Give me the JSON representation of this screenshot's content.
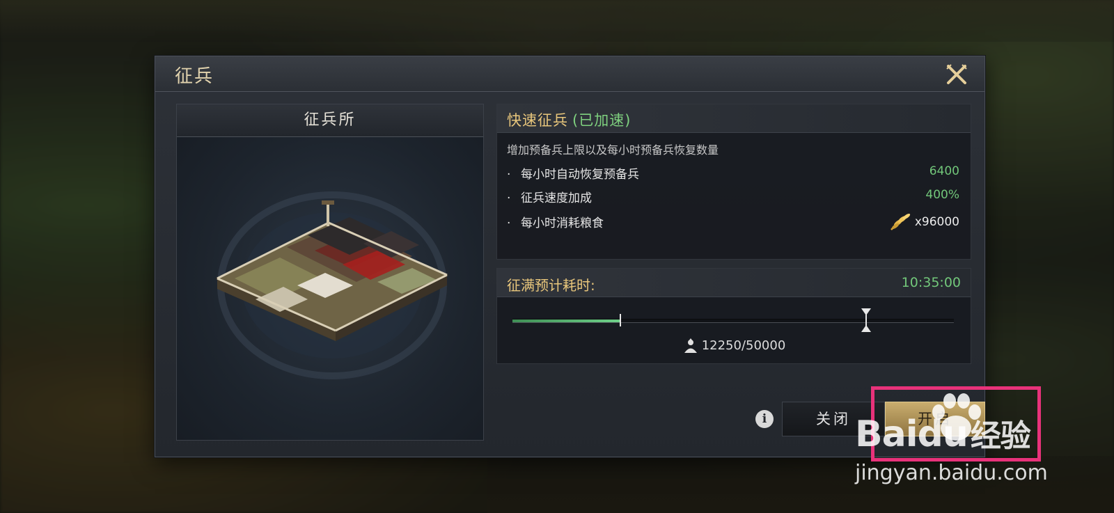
{
  "dialog": {
    "title": "征兵",
    "close_icon": "close-x-icon"
  },
  "building_panel": {
    "title": "征兵所",
    "image": "recruitment-camp-building"
  },
  "info": {
    "title": "快速征兵",
    "accelerated": "(已加速)",
    "description": "增加预备兵上限以及每小时预备兵恢复数量",
    "stats": [
      {
        "bullet": "·",
        "label": "每小时自动恢复预备兵",
        "value": "6400"
      },
      {
        "bullet": "·",
        "label": "征兵速度加成",
        "value": "400%"
      },
      {
        "bullet": "·",
        "label": "每小时消耗粮食",
        "value": "x96000",
        "icon": "grain-icon"
      }
    ]
  },
  "timer": {
    "label": "征满预计耗时:",
    "value": "10:35:00",
    "slider_progress": 0.245,
    "slider_max_marker": 0.802,
    "count_text": "12250/50000",
    "count_icon": "soldier-icon"
  },
  "buttons": {
    "info": "i",
    "close": "关闭",
    "start": "开启"
  },
  "watermark": {
    "logo_left": "Bai",
    "logo_right": "du",
    "logo_cn": "经验",
    "url": "jingyan.baidu.com"
  },
  "colors": {
    "gold": "#e9c77c",
    "green": "#72c77a",
    "highlight": "#e8327a"
  }
}
